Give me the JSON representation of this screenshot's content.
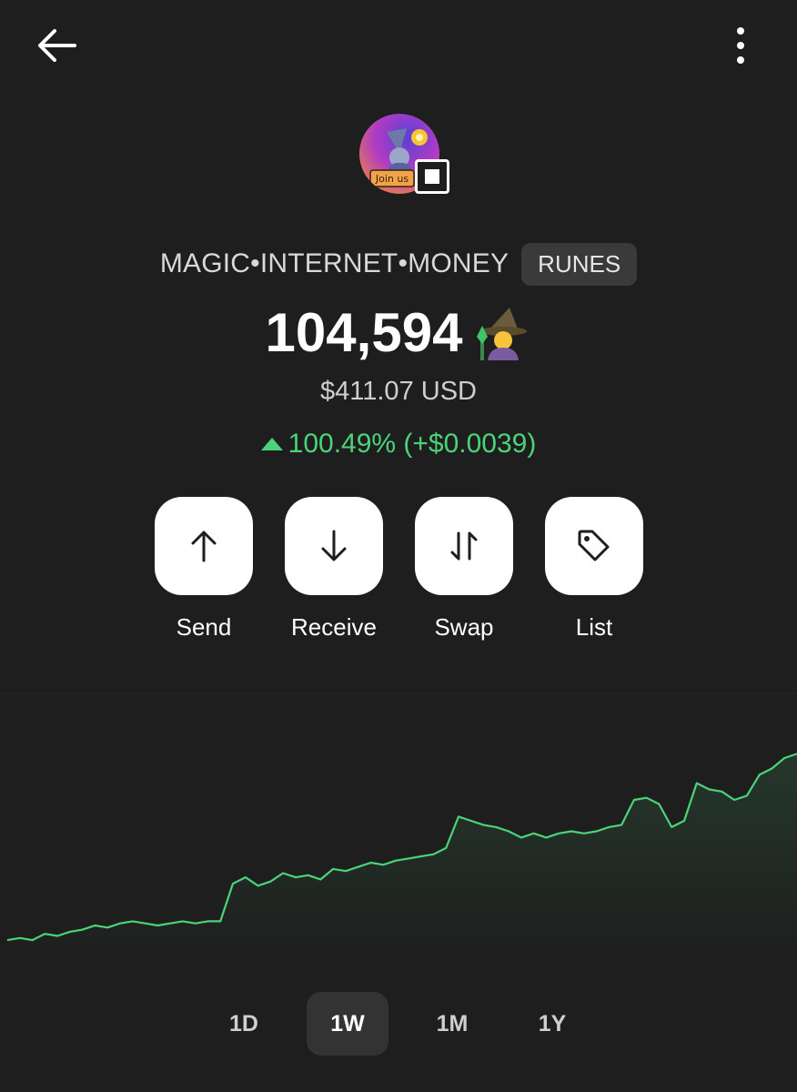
{
  "header": {
    "back_icon": "arrow-left-icon",
    "menu_icon": "more-vertical-icon"
  },
  "token": {
    "name": "MAGIC•INTERNET•MONEY",
    "badge": "RUNES",
    "balance": "104,594",
    "balance_emoji": "🧙",
    "usd_value": "$411.07 USD",
    "change_text": "100.49% (+$0.0039)",
    "change_direction": "up",
    "avatar_caption": "Join us",
    "chain_icon": "bitcoin-ordinals-square-icon"
  },
  "actions": [
    {
      "label": "Send",
      "icon": "arrow-up-icon"
    },
    {
      "label": "Receive",
      "icon": "arrow-down-icon"
    },
    {
      "label": "Swap",
      "icon": "swap-arrows-icon"
    },
    {
      "label": "List",
      "icon": "tag-icon"
    }
  ],
  "chart_data": {
    "type": "area",
    "title": "",
    "xlabel": "",
    "ylabel": "",
    "grid": false,
    "ylim": [
      0,
      100
    ],
    "values": [
      3,
      4,
      3,
      6,
      5,
      7,
      8,
      10,
      9,
      11,
      12,
      11,
      10,
      11,
      12,
      11,
      12,
      12,
      30,
      33,
      29,
      31,
      35,
      33,
      34,
      32,
      37,
      36,
      38,
      40,
      39,
      41,
      42,
      43,
      44,
      47,
      62,
      60,
      58,
      57,
      55,
      52,
      54,
      52,
      54,
      55,
      54,
      55,
      57,
      58,
      70,
      71,
      68,
      57,
      60,
      78,
      75,
      74,
      70,
      72,
      82,
      85,
      90,
      92
    ],
    "line_color": "#4cd37a"
  },
  "timeframes": {
    "options": [
      "1D",
      "1W",
      "1M",
      "1Y"
    ],
    "selected": "1W"
  },
  "colors": {
    "background": "#1e1e1e",
    "positive": "#4cd37a"
  }
}
